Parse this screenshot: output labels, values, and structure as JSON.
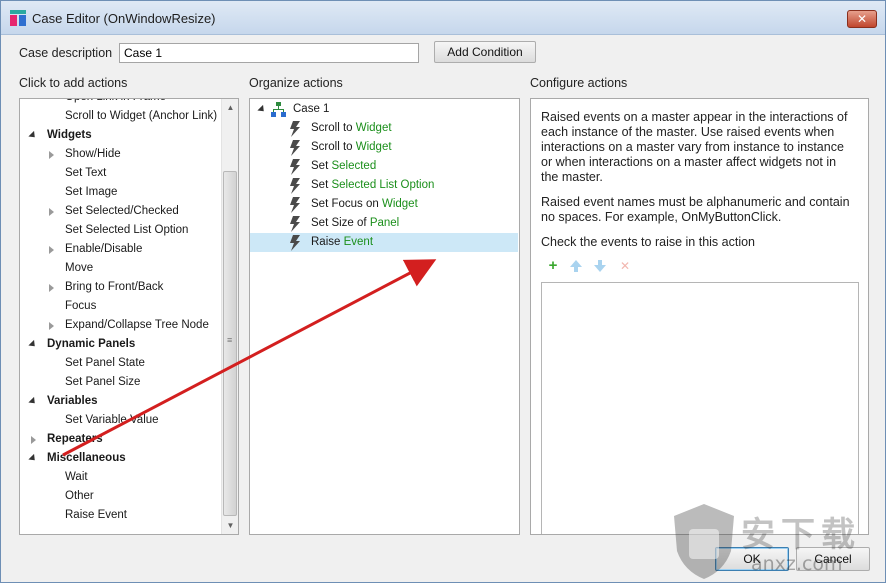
{
  "window": {
    "title": "Case Editor (OnWindowResize)",
    "close_glyph": "✕"
  },
  "case": {
    "description_label": "Case description",
    "description_value": "Case 1",
    "add_condition_label": "Add Condition"
  },
  "left": {
    "header": "Click to add actions",
    "items": [
      {
        "label": "Open Link in Frame",
        "type": "item"
      },
      {
        "label": "Scroll to Widget (Anchor Link)",
        "type": "item"
      },
      {
        "label": "Widgets",
        "type": "group"
      },
      {
        "label": "Show/Hide",
        "type": "expandable"
      },
      {
        "label": "Set Text",
        "type": "item"
      },
      {
        "label": "Set Image",
        "type": "item"
      },
      {
        "label": "Set Selected/Checked",
        "type": "expandable"
      },
      {
        "label": "Set Selected List Option",
        "type": "item"
      },
      {
        "label": "Enable/Disable",
        "type": "expandable"
      },
      {
        "label": "Move",
        "type": "item"
      },
      {
        "label": "Bring to Front/Back",
        "type": "expandable"
      },
      {
        "label": "Focus",
        "type": "item"
      },
      {
        "label": "Expand/Collapse Tree Node",
        "type": "expandable"
      },
      {
        "label": "Dynamic Panels",
        "type": "group"
      },
      {
        "label": "Set Panel State",
        "type": "item"
      },
      {
        "label": "Set Panel Size",
        "type": "item"
      },
      {
        "label": "Variables",
        "type": "group"
      },
      {
        "label": "Set Variable Value",
        "type": "item"
      },
      {
        "label": "Repeaters",
        "type": "group-collapsed"
      },
      {
        "label": "Miscellaneous",
        "type": "group"
      },
      {
        "label": "Wait",
        "type": "item"
      },
      {
        "label": "Other",
        "type": "item"
      },
      {
        "label": "Raise Event",
        "type": "item"
      }
    ]
  },
  "middle": {
    "header": "Organize actions",
    "case_label": "Case 1",
    "actions": [
      {
        "prefix": "Scroll to ",
        "target": "Widget"
      },
      {
        "prefix": "Scroll to ",
        "target": "Widget"
      },
      {
        "prefix": "Set ",
        "target": "Selected"
      },
      {
        "prefix": "Set ",
        "target": "Selected List Option"
      },
      {
        "prefix": "Set Focus on ",
        "target": "Widget"
      },
      {
        "prefix": "Set Size of ",
        "target": "Panel"
      },
      {
        "prefix": "Raise ",
        "target": "Event"
      }
    ]
  },
  "right": {
    "header": "Configure actions",
    "para1": "Raised events on a master appear in the interactions of each instance of the master. Use raised events when interactions on a master vary from instance to instance or when interactions on a master affect widgets not in the master.",
    "para2": "Raised event names must be alphanumeric and contain no spaces. For example, OnMyButtonClick.",
    "para3": "Check the events to raise in this action",
    "tools": {
      "add": "+",
      "delete": "✕"
    }
  },
  "footer": {
    "ok_label": "OK",
    "cancel_label": "Cancel"
  },
  "watermark": {
    "text1": "安下载",
    "text2": "anxz.com"
  },
  "colors": {
    "green": "#1b8f1b",
    "selection": "#cde8f7",
    "arrow": "#d31f1f"
  }
}
